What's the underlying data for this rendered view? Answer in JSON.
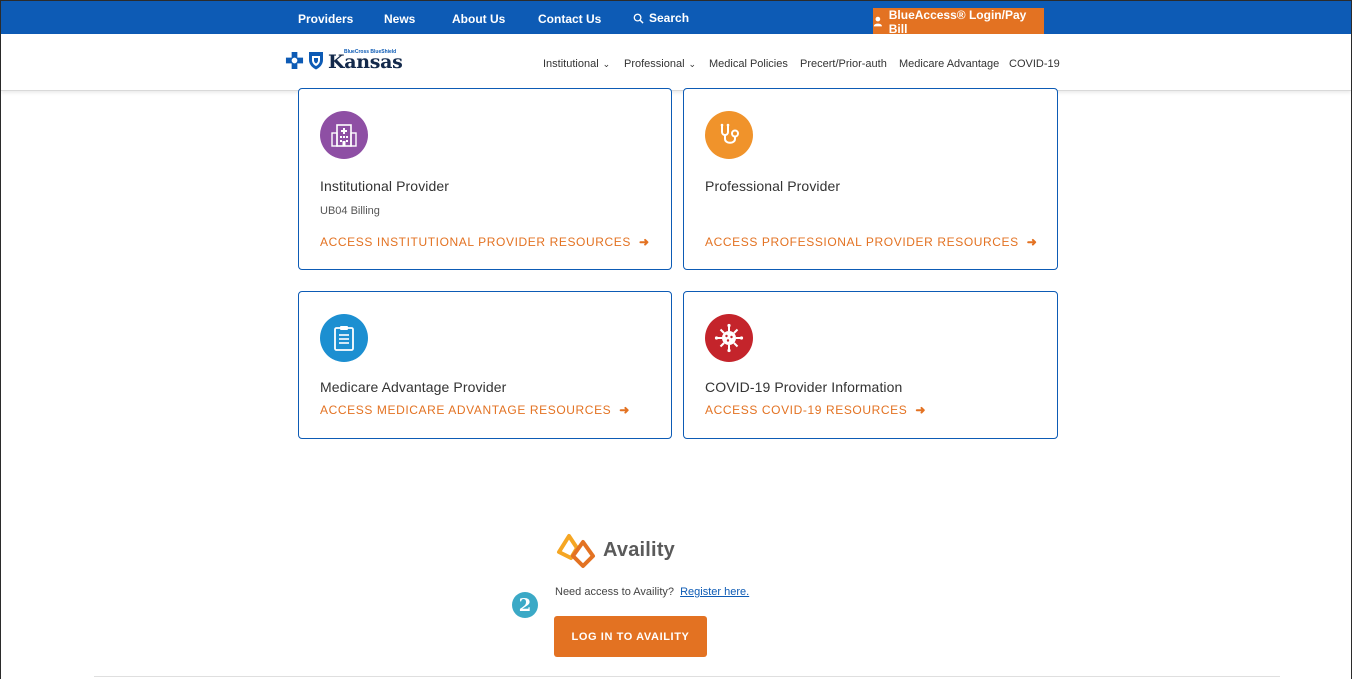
{
  "topbar": {
    "links": [
      "Providers",
      "News",
      "About Us",
      "Contact Us"
    ],
    "search_label": "Search",
    "login_label": "BlueAccess® Login/Pay Bill"
  },
  "header": {
    "logo_small": "BlueCross BlueShield",
    "logo_big": "Kansas",
    "nav": [
      {
        "label": "Institutional",
        "dropdown": true
      },
      {
        "label": "Professional",
        "dropdown": true
      },
      {
        "label": "Medical Policies",
        "dropdown": false
      },
      {
        "label": "Precert/Prior-auth",
        "dropdown": false
      },
      {
        "label": "Medicare Advantage",
        "dropdown": false
      },
      {
        "label": "COVID-19",
        "dropdown": false
      }
    ]
  },
  "cards": [
    {
      "title": "Institutional Provider",
      "subtitle": "UB04 Billing",
      "cta": "ACCESS INSTITUTIONAL PROVIDER RESOURCES",
      "icon": "hospital-icon",
      "color": "#8e4fa4"
    },
    {
      "title": "Professional Provider",
      "subtitle": "",
      "cta": "ACCESS PROFESSIONAL PROVIDER RESOURCES",
      "icon": "stethoscope-icon",
      "color": "#f0932b"
    },
    {
      "title": "Medicare Advantage Provider",
      "subtitle": "",
      "cta": "ACCESS MEDICARE ADVANTAGE RESOURCES",
      "icon": "clipboard-icon",
      "color": "#1c8fd1"
    },
    {
      "title": "COVID-19 Provider Information",
      "subtitle": "",
      "cta": "ACCESS COVID-19 RESOURCES",
      "icon": "virus-icon",
      "color": "#c4242b"
    }
  ],
  "availity": {
    "logo_text": "Availity",
    "prompt": "Need access to Availity?",
    "register_link": "Register here.",
    "button": "LOG IN TO AVAILITY",
    "step_number": "2"
  },
  "colors": {
    "brand_blue": "#0d5bb5",
    "accent_orange": "#e37222"
  }
}
